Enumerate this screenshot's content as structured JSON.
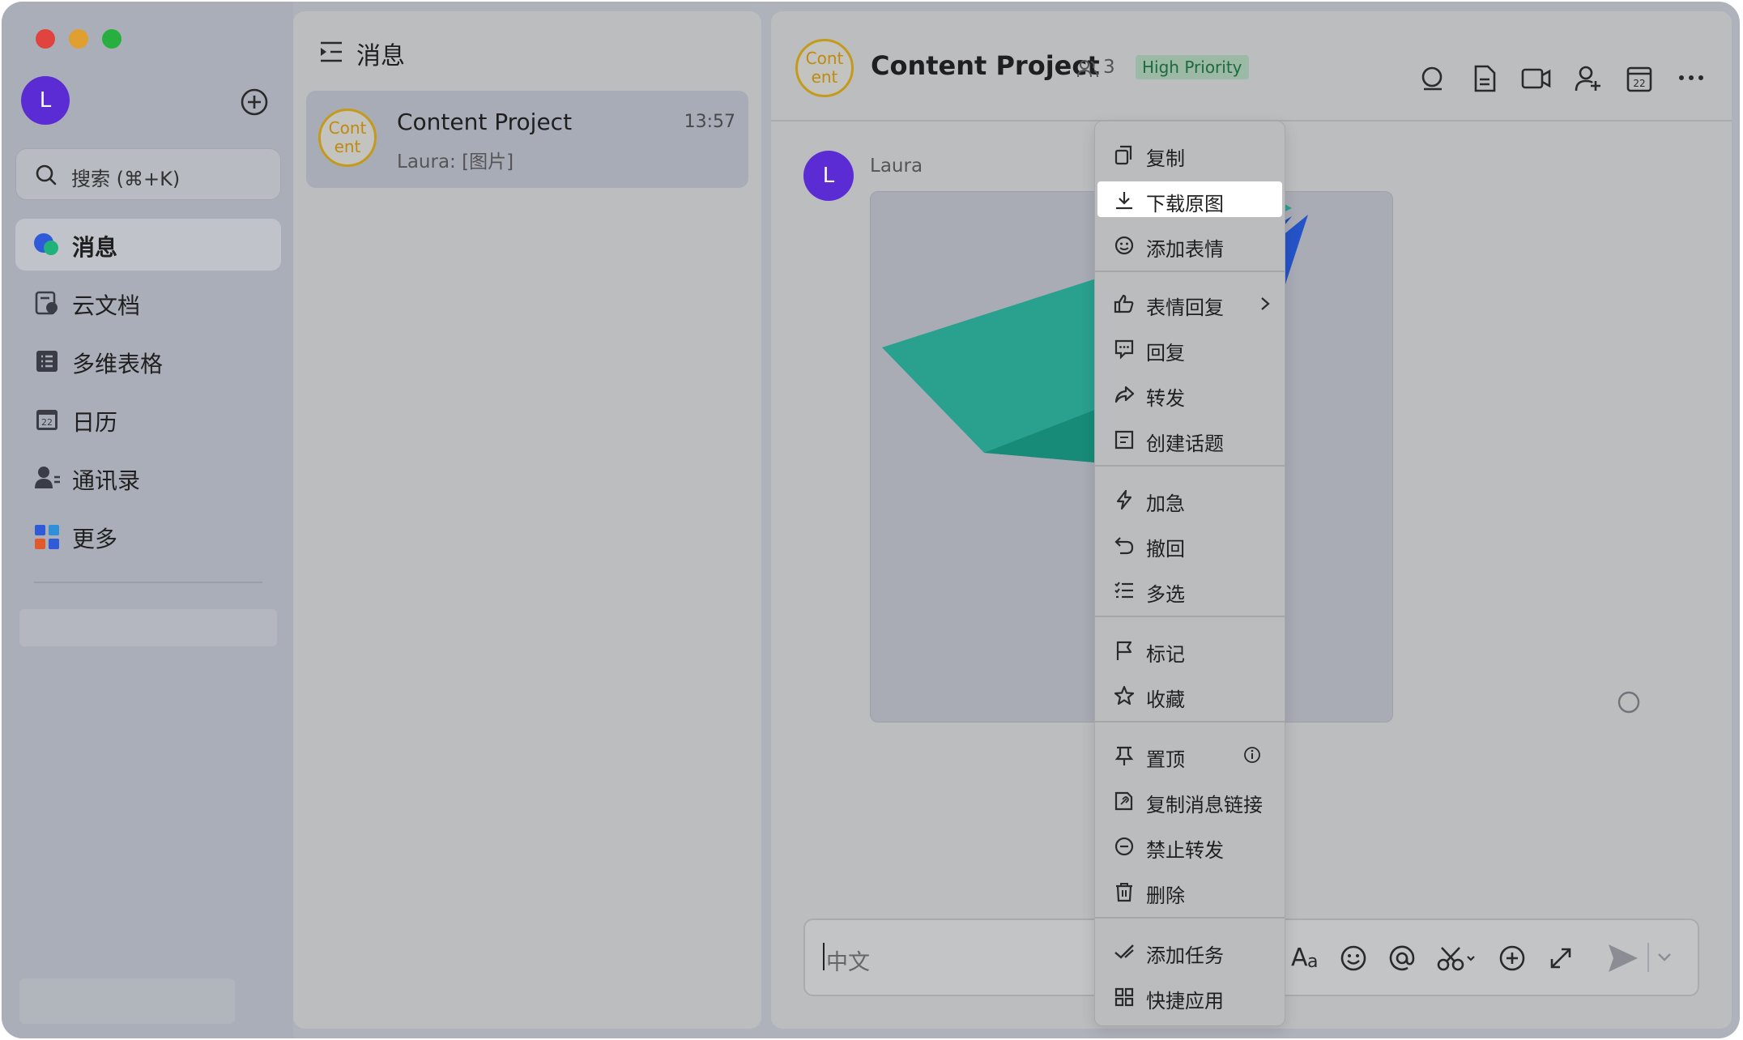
{
  "sidebar": {
    "user_initial": "L",
    "search_label": "搜索 (⌘+K)",
    "nav": [
      {
        "label": "消息",
        "icon": "messages-icon"
      },
      {
        "label": "云文档",
        "icon": "docs-icon"
      },
      {
        "label": "多维表格",
        "icon": "base-table-icon"
      },
      {
        "label": "日历",
        "icon": "calendar-icon"
      },
      {
        "label": "通讯录",
        "icon": "contacts-icon"
      },
      {
        "label": "更多",
        "icon": "more-apps-icon"
      }
    ]
  },
  "list": {
    "title": "消息",
    "chat": {
      "avatar_text": "Cont ent",
      "name": "Content Project",
      "time": "13:57",
      "preview": "Laura: [图片]"
    }
  },
  "chat": {
    "avatar_text": "Cont ent",
    "title": "Content Project",
    "member_count": "3",
    "tag": "High Priority",
    "sender_initial": "L",
    "sender": "Laura",
    "input_placeholder": "中文"
  },
  "context_menu": {
    "items": [
      {
        "label": "复制",
        "icon": "copy-icon"
      },
      {
        "label": "下载原图",
        "icon": "download-icon",
        "highlighted": true
      },
      {
        "label": "添加表情",
        "icon": "add-emoji-icon"
      },
      {
        "label": "表情回复",
        "icon": "thumbs-up-icon",
        "submenu": true
      },
      {
        "label": "回复",
        "icon": "reply-icon"
      },
      {
        "label": "转发",
        "icon": "forward-icon"
      },
      {
        "label": "创建话题",
        "icon": "topic-icon"
      },
      {
        "label": "加急",
        "icon": "lightning-icon"
      },
      {
        "label": "撤回",
        "icon": "undo-icon"
      },
      {
        "label": "多选",
        "icon": "multi-select-icon"
      },
      {
        "label": "标记",
        "icon": "flag-icon"
      },
      {
        "label": "收藏",
        "icon": "star-icon"
      },
      {
        "label": "置顶",
        "icon": "pin-icon",
        "info": true
      },
      {
        "label": "复制消息链接",
        "icon": "link-icon"
      },
      {
        "label": "禁止转发",
        "icon": "no-forward-icon"
      },
      {
        "label": "删除",
        "icon": "trash-icon"
      },
      {
        "label": "添加任务",
        "icon": "task-check-icon"
      },
      {
        "label": "快捷应用",
        "icon": "grid-apps-icon"
      }
    ]
  },
  "colors": {
    "avatar_purple": "#5b2bd4",
    "content_gold": "#c49a1c",
    "tag_green": "#1c6a3e"
  }
}
